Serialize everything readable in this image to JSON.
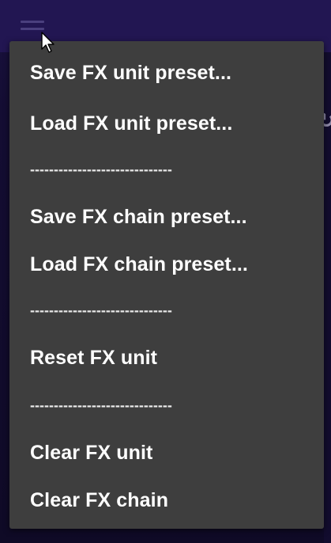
{
  "app": {
    "peek_glyph": "↻"
  },
  "menu": {
    "items": [
      {
        "label": "Save FX unit preset...",
        "type": "item"
      },
      {
        "label": "Load FX unit preset...",
        "type": "item"
      },
      {
        "label": "------------------------------",
        "type": "separator"
      },
      {
        "label": "Save FX chain preset...",
        "type": "item"
      },
      {
        "label": "Load FX chain preset...",
        "type": "item"
      },
      {
        "label": "------------------------------",
        "type": "separator"
      },
      {
        "label": "Reset FX unit",
        "type": "item"
      },
      {
        "label": "------------------------------",
        "type": "separator"
      },
      {
        "label": "Clear FX unit",
        "type": "item"
      },
      {
        "label": "Clear FX chain",
        "type": "item"
      }
    ]
  }
}
